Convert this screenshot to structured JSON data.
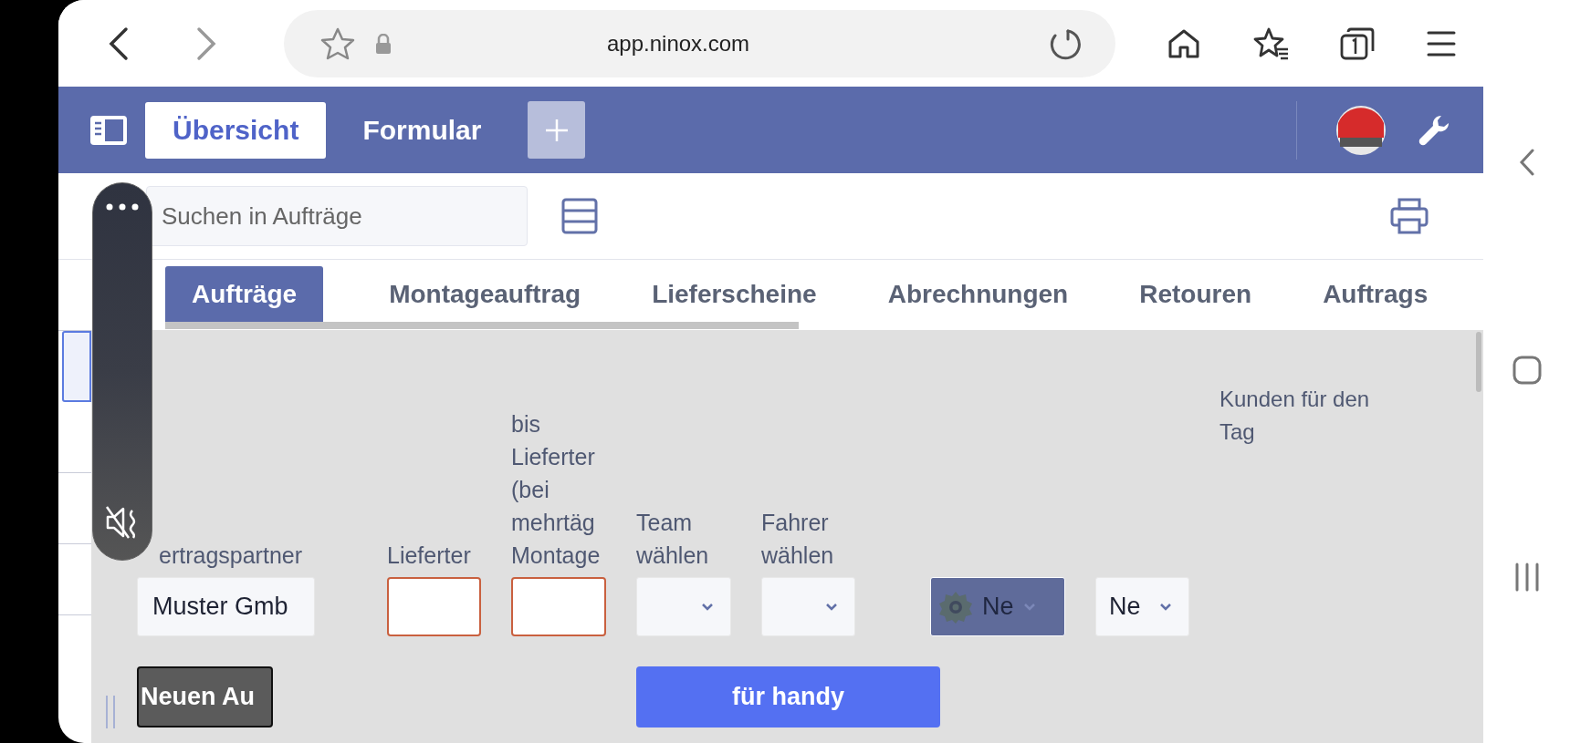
{
  "browser": {
    "url": "app.ninox.com"
  },
  "header_tabs": [
    {
      "label": "Übersicht",
      "selected": true
    },
    {
      "label": "Formular",
      "selected": false
    }
  ],
  "search": {
    "placeholder": "Suchen in Aufträge"
  },
  "side_rows": [
    {
      "selected": false
    },
    {
      "selected": true
    },
    {
      "selected": false
    },
    {
      "selected": false
    },
    {
      "selected": false
    }
  ],
  "table_tabs": [
    {
      "label": "Aufträge",
      "selected": true
    },
    {
      "label": "Montageauftrag",
      "selected": false
    },
    {
      "label": "Lieferscheine",
      "selected": false
    },
    {
      "label": "Abrechnungen",
      "selected": false
    },
    {
      "label": "Retouren",
      "selected": false
    },
    {
      "label": "Auftrags",
      "selected": false
    }
  ],
  "form_fields": [
    {
      "kind": "text",
      "label": "ertragspartner",
      "value": "Muster Gmb"
    },
    {
      "kind": "date",
      "label": "Lieferter"
    },
    {
      "kind": "date",
      "label": "bis Lieferter (bei mehrtäg Montage"
    },
    {
      "kind": "select",
      "label": "Team wählen"
    },
    {
      "kind": "select",
      "label": "Fahrer wählen"
    },
    {
      "kind": "icon_select",
      "value": "Ne"
    },
    {
      "kind": "select",
      "value": "Ne"
    },
    {
      "kind": "label",
      "label": "Kunden für den Tag"
    }
  ],
  "buttons": [
    {
      "kind": "dark",
      "label": "Neuen Au"
    },
    {
      "kind": "primary",
      "label": "für handy"
    }
  ]
}
